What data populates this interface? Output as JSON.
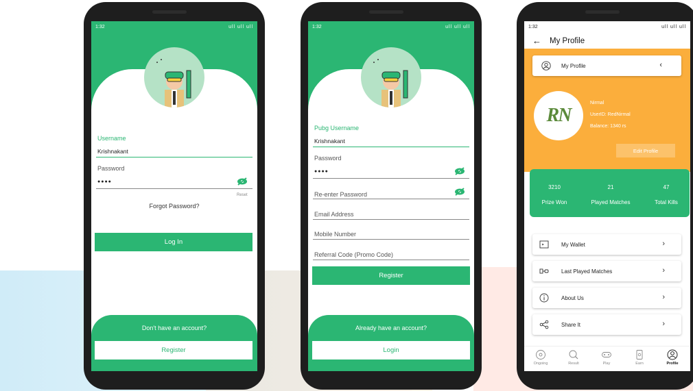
{
  "status": {
    "time": "1:32",
    "right": "ull ull ull"
  },
  "login": {
    "username_label": "Username",
    "username_value": "Krishnakant",
    "password_label": "Password",
    "password_value": "●●●●",
    "reset": "Reset",
    "forgot": "Forgot Password?",
    "login_button": "Log In",
    "footer_prompt": "Don't have an account?",
    "register_button": "Register"
  },
  "register": {
    "username_label": "Pubg Username",
    "username_value": "Krishnakant",
    "password_label": "Password",
    "password_value": "●●●●",
    "reenter_label": "Re-enter Password",
    "email_label": "Email Address",
    "mobile_label": "Mobile Number",
    "referral_label": "Referral Code (Promo Code)",
    "register_button": "Register",
    "footer_prompt": "Already have an account?",
    "login_button": "Login"
  },
  "profile": {
    "title": "My Profile",
    "card_label": "My Profile",
    "logo_text": "RN",
    "name": "Nirmal",
    "user_id": "UserID: RedNirmal",
    "balance": "Balance: 1340 rs",
    "edit_button": "Edit Profile",
    "stats": [
      {
        "value": "3210",
        "label": "Prize Won"
      },
      {
        "value": "21",
        "label": "Played Matches"
      },
      {
        "value": "47",
        "label": "Total Kills"
      }
    ],
    "menu": [
      {
        "label": "My Wallet",
        "icon": "wallet-icon"
      },
      {
        "label": "Last Played Matches",
        "icon": "matches-icon"
      },
      {
        "label": "About Us",
        "icon": "info-icon"
      },
      {
        "label": "Share It",
        "icon": "share-icon"
      }
    ],
    "nav": [
      {
        "label": "Ongoing",
        "icon": "ongoing-icon"
      },
      {
        "label": "Result",
        "icon": "result-icon"
      },
      {
        "label": "Play",
        "icon": "play-icon"
      },
      {
        "label": "Earn",
        "icon": "earn-icon"
      },
      {
        "label": "Profile",
        "icon": "profile-icon"
      }
    ]
  },
  "colors": {
    "accent": "#2bb673",
    "orange": "#fbae3c"
  }
}
